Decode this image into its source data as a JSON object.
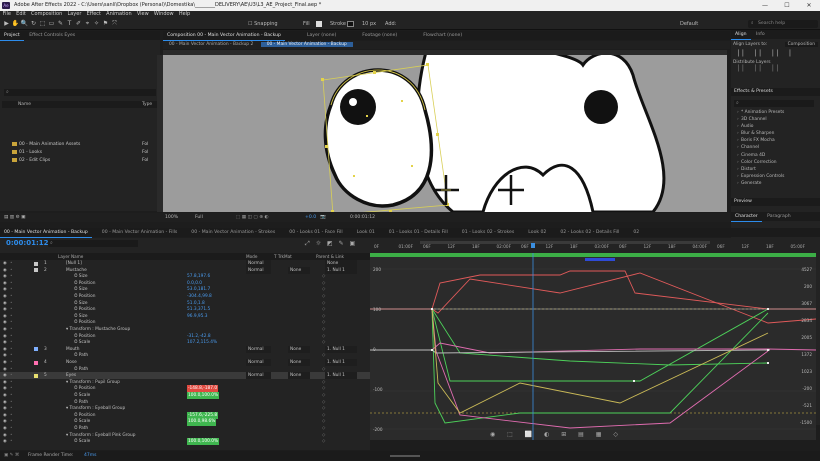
{
  "window": {
    "title": "Adobe After Effects 2022 - C:\\Users\\sanli\\Dropbox (Personal)\\Domestika\\________DELIVERY\\AE\\U3\\L3_AE_Project_Final.aep *",
    "min_label": "—",
    "max_label": "☐",
    "close_label": "✕",
    "app_icon_label": "Ae"
  },
  "menu": [
    "File",
    "Edit",
    "Composition",
    "Layer",
    "Effect",
    "Animation",
    "View",
    "Window",
    "Help"
  ],
  "toolbar": {
    "tools": [
      "▶",
      "✋",
      "🔍",
      "↻",
      "⬚",
      "▭",
      "✎",
      "T",
      "✐",
      "⌖",
      "✧",
      "⚑",
      "⤧"
    ],
    "snapping_label": "Snapping",
    "fill_label": "Fill",
    "stroke_label": "Stroke",
    "stroke_value": "10 px",
    "add_label": "Add:",
    "workspace_label": "Default",
    "search_placeholder": "Search help"
  },
  "project_panel": {
    "tab": "Project",
    "tab2": "Effect Controls Eyes",
    "col_name": "Name",
    "col_type": "Type",
    "items": [
      {
        "name": "00 - Main Animation Assets",
        "type": "Fol"
      },
      {
        "name": "01 - Looks",
        "type": "Fol"
      },
      {
        "name": "02 - Edit Clips",
        "type": "Fol"
      }
    ],
    "bpc": "8 bpc"
  },
  "comp_panel": {
    "tabs": [
      "Composition 00 - Main Vector Animation - Backup",
      "Layer (none)",
      "Footage (none)",
      "Flowchart (none)"
    ],
    "breadcrumbs": [
      "00 - Main Vector Animation - Backup 2",
      "00 - Main Vector Animation - Backup"
    ],
    "zoom": "100%",
    "resolution": "Full",
    "exposure": "+0.0",
    "timecode": "0:00:01:12"
  },
  "right_panel": {
    "tabs": [
      "Align",
      "Info"
    ],
    "align_label": "Align Layers to:",
    "align_target": "Composition",
    "distribute_label": "Distribute Layers",
    "effects_title": "Effects & Presets",
    "effects": [
      "* Animation Presets",
      "3D Channel",
      "Audio",
      "Blur & Sharpen",
      "Boris FX Mocha",
      "Channel",
      "Cinema 4D",
      "Color Correction",
      "Distort",
      "Expression Controls",
      "Generate"
    ],
    "preview_title": "Preview",
    "character_title": "Character",
    "paragraph_title": "Paragraph"
  },
  "timeline": {
    "tabs": [
      "00 - Main Vector Animation - Backup",
      "00 - Main Vector Animation - Fills",
      "00 - Main Vector Animation - Strokes",
      "00 - Looks 01 - Face Fill",
      "Look 01",
      "01 - Looks 01 - Details Fill",
      "01 - Looks 02 - Strokes",
      "Look 02",
      "02 - Looks 02 - Details Fill",
      "02"
    ],
    "timecode": "0:00:01:12",
    "col_layer": "Layer Name",
    "col_mode": "Mode",
    "col_trkmat": "T TrkMat",
    "col_parent": "Parent & Link",
    "rows": [
      {
        "indent": 0,
        "idx": "1",
        "name": "[Null 1]",
        "mode": "Normal",
        "parent": "None",
        "color": "#c8c8c8"
      },
      {
        "indent": 0,
        "idx": "2",
        "name": "Mustache",
        "mode": "Normal",
        "trk": "None",
        "parent": "1. Null 1",
        "color": "#c8c8c8"
      },
      {
        "indent": 3,
        "prop": "Size",
        "value": "57.8,197.6"
      },
      {
        "indent": 3,
        "prop": "Position",
        "value": "0.0,0.0"
      },
      {
        "indent": 3,
        "prop": "Size",
        "value": "53.0,181.7"
      },
      {
        "indent": 3,
        "prop": "Position",
        "value": "-304.4,99.8"
      },
      {
        "indent": 3,
        "prop": "Size",
        "value": "51.0,1.8"
      },
      {
        "indent": 3,
        "prop": "Position",
        "value": "51.3,371.5"
      },
      {
        "indent": 3,
        "prop": "Size",
        "value": "96.9,95.3"
      },
      {
        "indent": 3,
        "prop": "Position",
        "value": ""
      },
      {
        "indent": 2,
        "prop": "Transform : Mustache Group",
        "value": ""
      },
      {
        "indent": 3,
        "prop": "Position",
        "value": "-31.2,-42.8"
      },
      {
        "indent": 3,
        "prop": "Scale",
        "value": "107.2,115.4%"
      },
      {
        "indent": 0,
        "idx": "3",
        "name": "Mouth",
        "mode": "Normal",
        "trk": "None",
        "parent": "1. Null 1",
        "color": "#7fb0ff"
      },
      {
        "indent": 3,
        "prop": "Path",
        "value": ""
      },
      {
        "indent": 0,
        "idx": "4",
        "name": "Nose",
        "mode": "Normal",
        "trk": "None",
        "parent": "1. Null 1",
        "color": "#ff6fb0"
      },
      {
        "indent": 3,
        "prop": "Path",
        "value": ""
      },
      {
        "indent": 0,
        "idx": "5",
        "name": "Eyes",
        "mode": "Normal",
        "trk": "None",
        "parent": "1. Null 1",
        "color": "#e8e070",
        "selected": true
      },
      {
        "indent": 2,
        "prop": "Transform : Pupil Group",
        "value": ""
      },
      {
        "indent": 3,
        "prop": "Position",
        "value": "-148.8,-187.0",
        "hl": "red"
      },
      {
        "indent": 3,
        "prop": "Scale",
        "value": "100.0,100.0%",
        "hl": "mix"
      },
      {
        "indent": 3,
        "prop": "Path",
        "value": ""
      },
      {
        "indent": 2,
        "prop": "Transform : Eyeball Group",
        "value": ""
      },
      {
        "indent": 3,
        "prop": "Position",
        "value": "-157.6,-225.8",
        "hl": "mix"
      },
      {
        "indent": 3,
        "prop": "Scale",
        "value": "100.0,98.6%",
        "hl": "mix"
      },
      {
        "indent": 3,
        "prop": "Path",
        "value": ""
      },
      {
        "indent": 2,
        "prop": "Transform : Eyeball Pink Group",
        "value": ""
      },
      {
        "indent": 3,
        "prop": "Scale",
        "value": "100.0,100.0%",
        "hl": "mix"
      }
    ],
    "ruler": [
      "0F",
      "01:00F",
      "06F",
      "12F",
      "18F",
      "02:00F",
      "06F",
      "12F",
      "18F",
      "03:00F",
      "06F",
      "12F",
      "18F",
      "04:00F",
      "06F",
      "12F",
      "18F",
      "05:00F"
    ],
    "y_labels_right": [
      "4527",
      "200",
      "3067",
      "2834",
      "2005",
      "1372",
      "1023",
      "-200",
      "-521",
      "-1500"
    ],
    "y_labels_left": [
      "200",
      "100",
      "0",
      "-100",
      "-200"
    ]
  },
  "status": {
    "frame_render": "Frame Render Time:",
    "frame_render_value": "47ms",
    "toggle_label": "Toggle Switches / Modes"
  },
  "colors": {
    "accent": "#2d8ceb",
    "playhead": "#3b8fe0",
    "selection_yellow": "#e3d34a",
    "graph_red": "#e05a5a",
    "graph_green": "#4dd15a",
    "graph_pink": "#e06cb0"
  }
}
